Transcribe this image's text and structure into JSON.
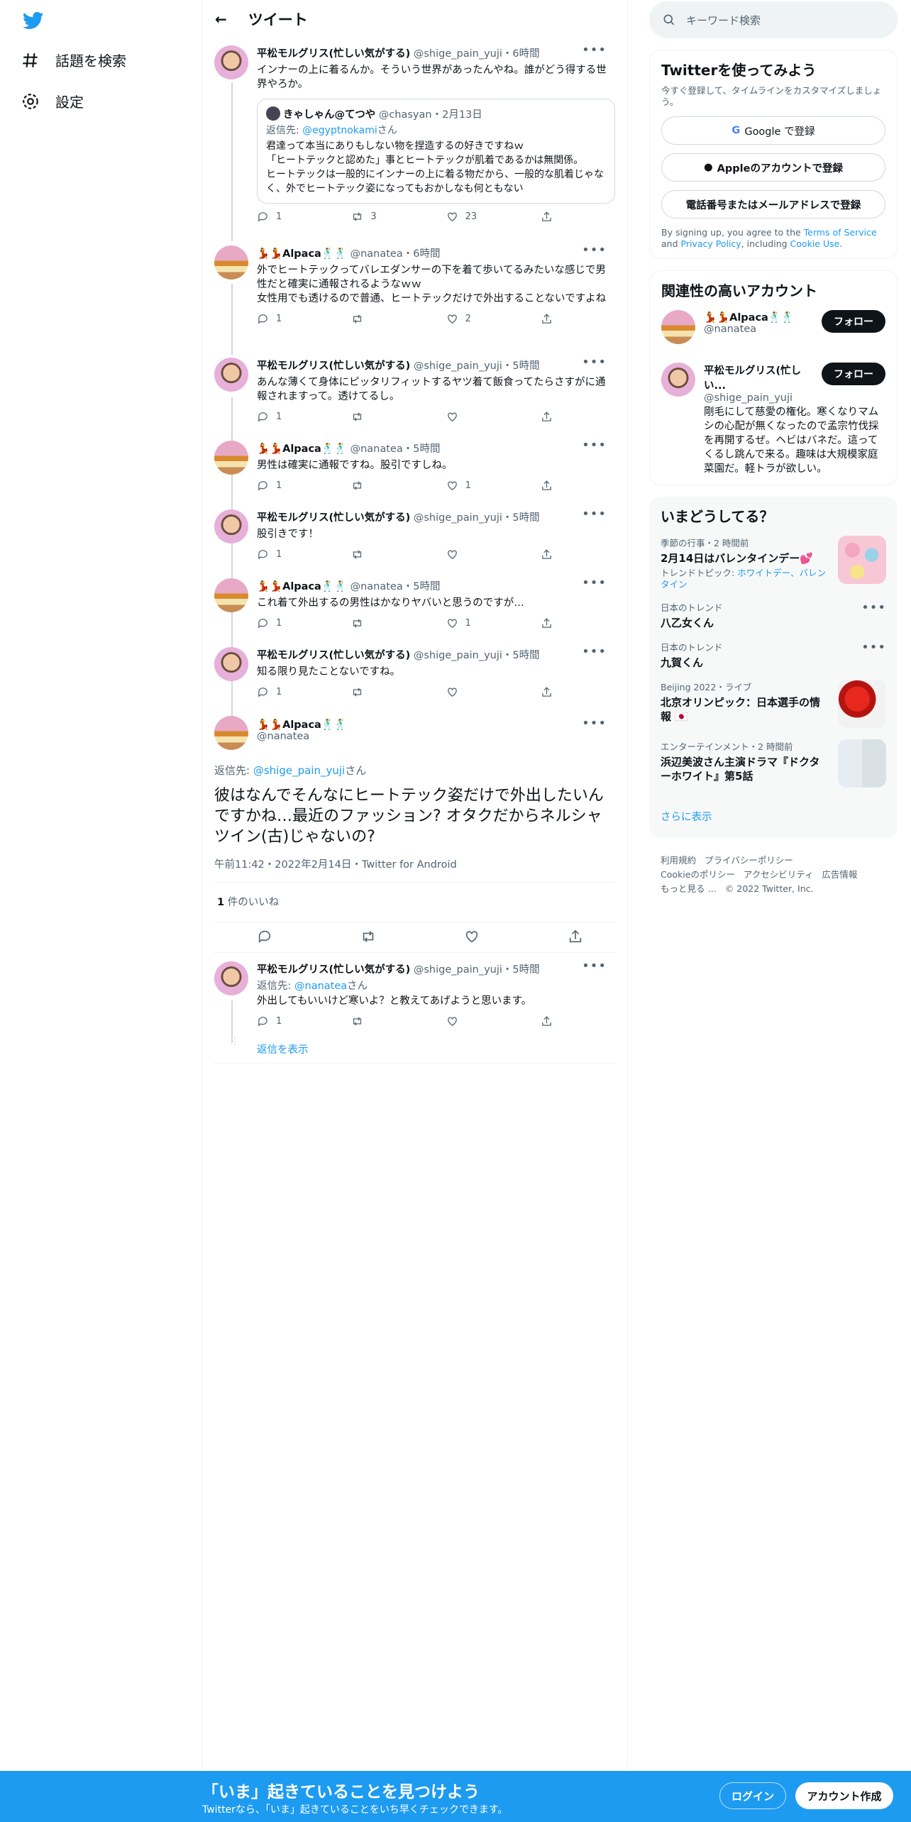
{
  "nav": {
    "explore": "話題を検索",
    "settings": "設定"
  },
  "header": {
    "title": "ツイート"
  },
  "tweets": [
    {
      "name": "平松モルグリス(忙しい気がする)",
      "handle": "@shige_pain_yuji",
      "time": "・6時間",
      "text": "インナーの上に着るんか。そういう世界があったんやね。誰がどう得する世界やろか。",
      "replies": "1",
      "retweets": "3",
      "likes": "23",
      "quote": {
        "name": "きゃしゃん@てつや",
        "handle": "@chasyan",
        "time": "・2月13日",
        "reply_prefix": "返信先: ",
        "reply_to": "@egyptnokami",
        "reply_suffix": "さん",
        "text": "君達って本当にありもしない物を捏造するの好きですねｗ\n「ヒートテックと認めた」事とヒートテックが肌着であるかは無関係。\nヒートテックは一般的にインナーの上に着る物だから、一般的な肌着じゃなく、外でヒートテック姿になってもおかしなも何ともない"
      }
    },
    {
      "name": "💃💃Alpaca🕺🕺",
      "handle": "@nanatea",
      "time": "・6時間",
      "text": "外でヒートテックってバレエダンサーの下を着て歩いてるみたいな感じで男性だと確実に通報されるようなｗｗ\n女性用でも透けるので普通、ヒートテックだけで外出することないですよね",
      "replies": "1",
      "retweets": "",
      "likes": "2"
    },
    {
      "name": "平松モルグリス(忙しい気がする)",
      "handle": "@shige_pain_yuji",
      "time": "・5時間",
      "text": "あんな薄くて身体にピッタリフィットするヤツ着て飯食ってたらさすがに通報されますって。透けてるし。",
      "replies": "1",
      "retweets": "",
      "likes": ""
    },
    {
      "name": "💃💃Alpaca🕺🕺",
      "handle": "@nanatea",
      "time": "・5時間",
      "text": "男性は確実に通報ですね。股引ですしね。",
      "replies": "1",
      "retweets": "",
      "likes": "1"
    },
    {
      "name": "平松モルグリス(忙しい気がする)",
      "handle": "@shige_pain_yuji",
      "time": "・5時間",
      "text": "股引きです！",
      "replies": "1",
      "retweets": "",
      "likes": ""
    },
    {
      "name": "💃💃Alpaca🕺🕺",
      "handle": "@nanatea",
      "time": "・5時間",
      "text": "これ着て外出するの男性はかなりヤバいと思うのですが…",
      "replies": "1",
      "retweets": "",
      "likes": "1"
    },
    {
      "name": "平松モルグリス(忙しい気がする)",
      "handle": "@shige_pain_yuji",
      "time": "・5時間",
      "text": "知る限り見たことないですね。",
      "replies": "1",
      "retweets": "",
      "likes": ""
    }
  ],
  "focus": {
    "name": "💃💃Alpaca🕺🕺",
    "handle": "@nanatea",
    "reply_prefix": "返信先: ",
    "reply_to": "@shige_pain_yuji",
    "reply_suffix": "さん",
    "text": "彼はなんでそんなにヒートテック姿だけで外出したいんですかね…最近のファッション? オタクだからネルシャツイン(古)じゃないの?",
    "meta": "午前11:42・2022年2月14日・Twitter for Android",
    "likes_count": "1",
    "likes_label": " 件のいいね"
  },
  "reply": {
    "name": "平松モルグリス(忙しい気がする)",
    "handle": "@shige_pain_yuji",
    "time": "・5時間",
    "reply_prefix": "返信先: ",
    "reply_to": "@nanatea",
    "reply_suffix": "さん",
    "text": "外出してもいいけど寒いよ？と教えてあげようと思います。",
    "replies": "1",
    "show_replies": "返信を表示"
  },
  "right": {
    "search_placeholder": "キーワード検索",
    "signup": {
      "title": "Twitterを使ってみよう",
      "sub": "今すぐ登録して、タイムラインをカスタマイズしましょう。",
      "google": "Google で登録",
      "apple": "Appleのアカウントで登録",
      "phone": "電話番号またはメールアドレスで登録",
      "legal_pre": "By signing up, you agree to the ",
      "tos": "Terms of Service",
      "and": " and ",
      "privacy": "Privacy Policy",
      "legal_mid": ", including ",
      "cookie": "Cookie Use",
      "legal_end": "."
    },
    "related": {
      "title": "関連性の高いアカウント",
      "follow": "フォロー",
      "accounts": [
        {
          "name": "💃💃Alpaca🕺🕺",
          "handle": "@nanatea"
        },
        {
          "name": "平松モルグリス(忙しい...",
          "handle": "@shige_pain_yuji",
          "bio": "剛毛にして慈愛の権化。寒くなりマムシの心配が無くなったので孟宗竹伐採を再開するぜ。ヘビはバネだ。這ってくるし跳んで来る。趣味は大規模家庭菜園だ。軽トラが欲しい。"
        }
      ]
    },
    "trends": {
      "title": "いまどうしてる？",
      "items": [
        {
          "cat": "季節の行事・2 時間前",
          "name": "2月14日はバレンタインデー💕",
          "topic_pre": "トレンドトピック: ",
          "topic": "ホワイトデー、バレンタイン"
        },
        {
          "cat": "日本のトレンド",
          "name": "八乙女くん"
        },
        {
          "cat": "日本のトレンド",
          "name": "九賀くん"
        },
        {
          "cat": "Beijing 2022・ライブ",
          "name": "北京オリンピック：日本選手の情報 🇯🇵"
        },
        {
          "cat": "エンターテインメント・2 時間前",
          "name": "浜辺美波さん主演ドラマ『ドクターホワイト』第5話"
        }
      ],
      "more": "さらに表示"
    },
    "footer": {
      "terms": "利用規約",
      "privacy": "プライバシーポリシー",
      "cookie": "Cookieのポリシー",
      "access": "アクセシビリティ",
      "ads": "広告情報",
      "more": "もっと見る …",
      "copy": "© 2022 Twitter, Inc."
    }
  },
  "banner": {
    "title": "「いま」起きていることを見つけよう",
    "sub": "Twitterなら、「いま」起きていることをいち早くチェックできます。",
    "login": "ログイン",
    "signup": "アカウント作成"
  },
  "colors": {
    "accent": "#1d9bf0"
  }
}
